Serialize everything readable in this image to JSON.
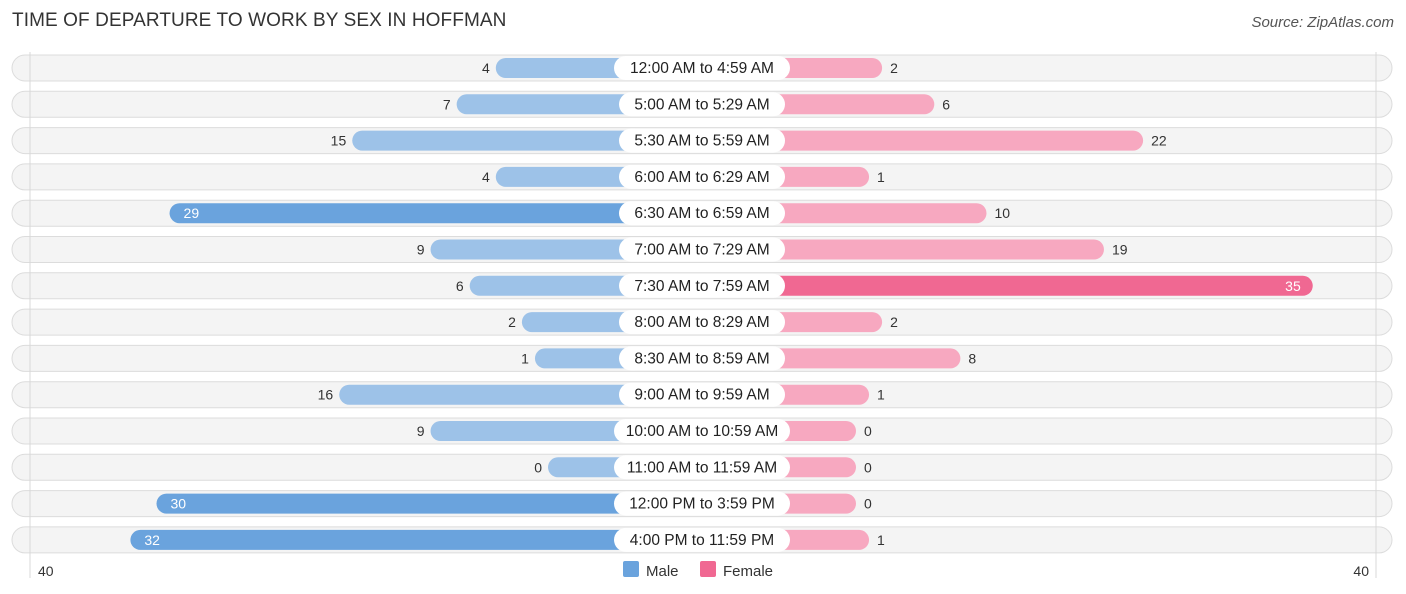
{
  "header": {
    "title": "TIME OF DEPARTURE TO WORK BY SEX IN HOFFMAN",
    "source": "Source: ZipAtlas.com"
  },
  "colors": {
    "male_dark": "#6aa3dd",
    "male_light": "#9dc2e8",
    "female_dark": "#f06892",
    "female_light": "#f7a8c0"
  },
  "chart_data": {
    "type": "bar",
    "orientation": "horizontal-diverging",
    "title": "TIME OF DEPARTURE TO WORK BY SEX IN HOFFMAN",
    "categories": [
      "12:00 AM to 4:59 AM",
      "5:00 AM to 5:29 AM",
      "5:30 AM to 5:59 AM",
      "6:00 AM to 6:29 AM",
      "6:30 AM to 6:59 AM",
      "7:00 AM to 7:29 AM",
      "7:30 AM to 7:59 AM",
      "8:00 AM to 8:29 AM",
      "8:30 AM to 8:59 AM",
      "9:00 AM to 9:59 AM",
      "10:00 AM to 10:59 AM",
      "11:00 AM to 11:59 AM",
      "12:00 PM to 3:59 PM",
      "4:00 PM to 11:59 PM"
    ],
    "series": [
      {
        "name": "Male",
        "values": [
          4,
          7,
          15,
          4,
          29,
          9,
          6,
          2,
          1,
          16,
          9,
          0,
          30,
          32
        ]
      },
      {
        "name": "Female",
        "values": [
          2,
          6,
          22,
          1,
          10,
          19,
          35,
          2,
          8,
          1,
          0,
          0,
          0,
          1
        ]
      }
    ],
    "axis": {
      "left_label": "40",
      "right_label": "40",
      "max": 40
    },
    "legend": {
      "placement": "bottom-center",
      "items": [
        "Male",
        "Female"
      ]
    }
  }
}
